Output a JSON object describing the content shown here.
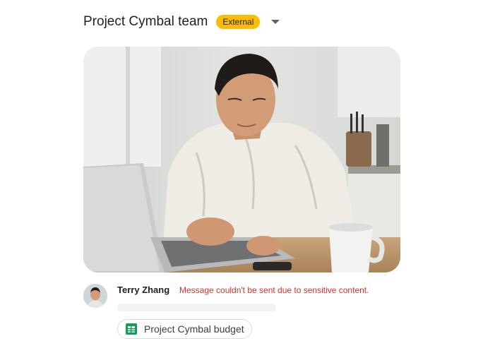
{
  "header": {
    "title": "Project Cymbal team",
    "badge": "External",
    "dropdown_icon": "arrow-drop-down-icon"
  },
  "message": {
    "sender": "Terry Zhang",
    "error_text": "Message couldn't be sent due to sensitive content.",
    "avatar_icon": "user-avatar"
  },
  "attachment": {
    "label": "Project Cymbal budget",
    "icon": "google-sheets-icon"
  },
  "colors": {
    "badge": "#fbbc04",
    "error": "#d93025",
    "sheets_green": "#0f9d58"
  }
}
